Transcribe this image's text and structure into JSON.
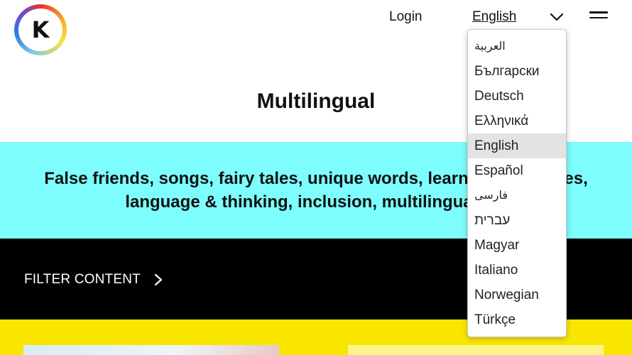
{
  "header": {
    "logo_letter": "K",
    "login_label": "Login",
    "current_language": "English"
  },
  "main": {
    "title": "Multilingual",
    "tagline": "False friends, songs, fairy tales, unique words, learning languages, language & thinking, inclusion, multilingualism"
  },
  "filter": {
    "label": "FILTER CONTENT"
  },
  "language_dropdown": {
    "selected": "English",
    "options": [
      "العربية",
      "Български",
      "Deutsch",
      "Ελληνικά",
      "English",
      "Español",
      "فارسی",
      "עברית",
      "Magyar",
      "Italiano",
      "Norwegian",
      "Türkçe"
    ]
  },
  "colors": {
    "cyan_band": "#7dfdfd",
    "black_band": "#000000",
    "yellow_band": "#f9e600",
    "dropdown_selected_bg": "#e3e3e6"
  },
  "icons": [
    "logo-k-icon",
    "chevron-down-icon",
    "hamburger-menu-icon",
    "chevron-right-icon"
  ]
}
